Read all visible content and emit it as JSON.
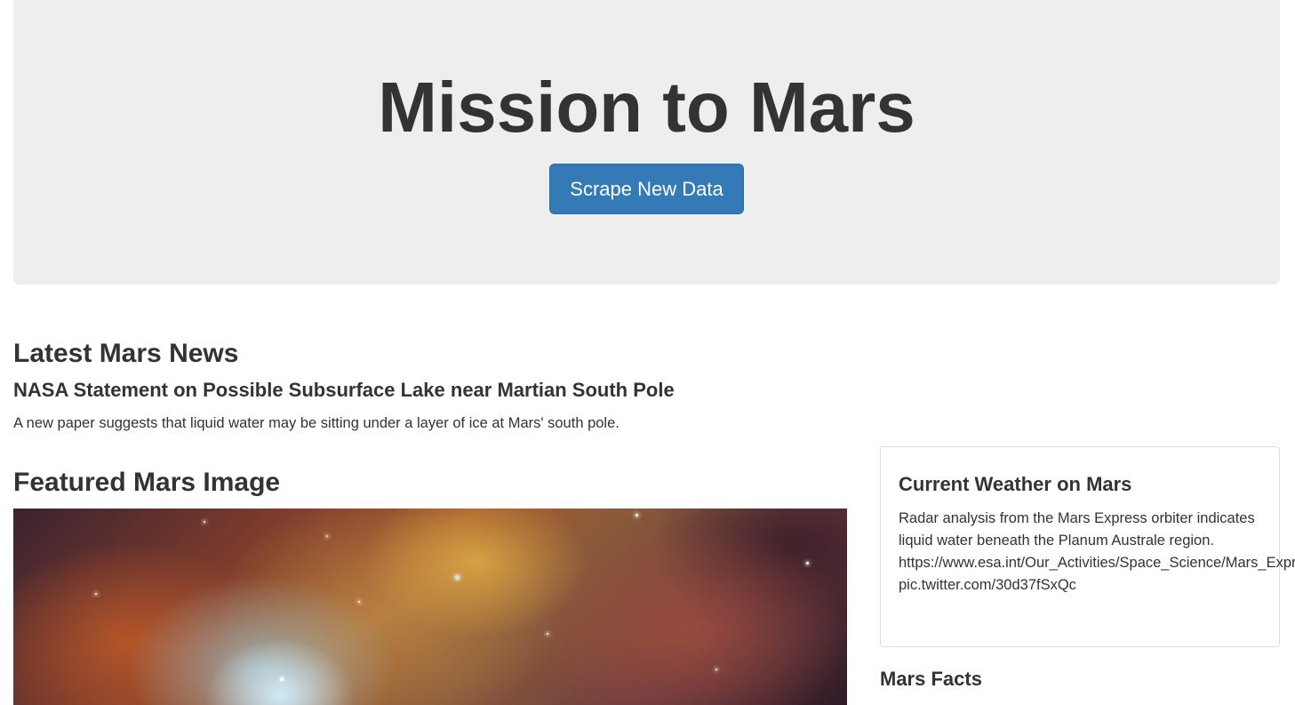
{
  "header": {
    "title": "Mission to Mars",
    "scrape_button_label": "Scrape New Data",
    "button_color": "#337ab7"
  },
  "news": {
    "heading": "Latest Mars News",
    "title": "NASA Statement on Possible Subsurface Lake near Martian South Pole",
    "paragraph": "A new paper suggests that liquid water may be sitting under a layer of ice at Mars' south pole."
  },
  "featured_image": {
    "heading": "Featured Mars Image"
  },
  "weather": {
    "heading": "Current Weather on Mars",
    "text": "Radar analysis from the Mars Express orbiter indicates liquid water beneath the Planum Australe region.",
    "url": "https://www.esa.int/Our_Activities/Space_Science/Mars_Express",
    "twitter_link": "pic.twitter.com/30d37fSxQc"
  },
  "facts": {
    "heading": "Mars Facts"
  }
}
